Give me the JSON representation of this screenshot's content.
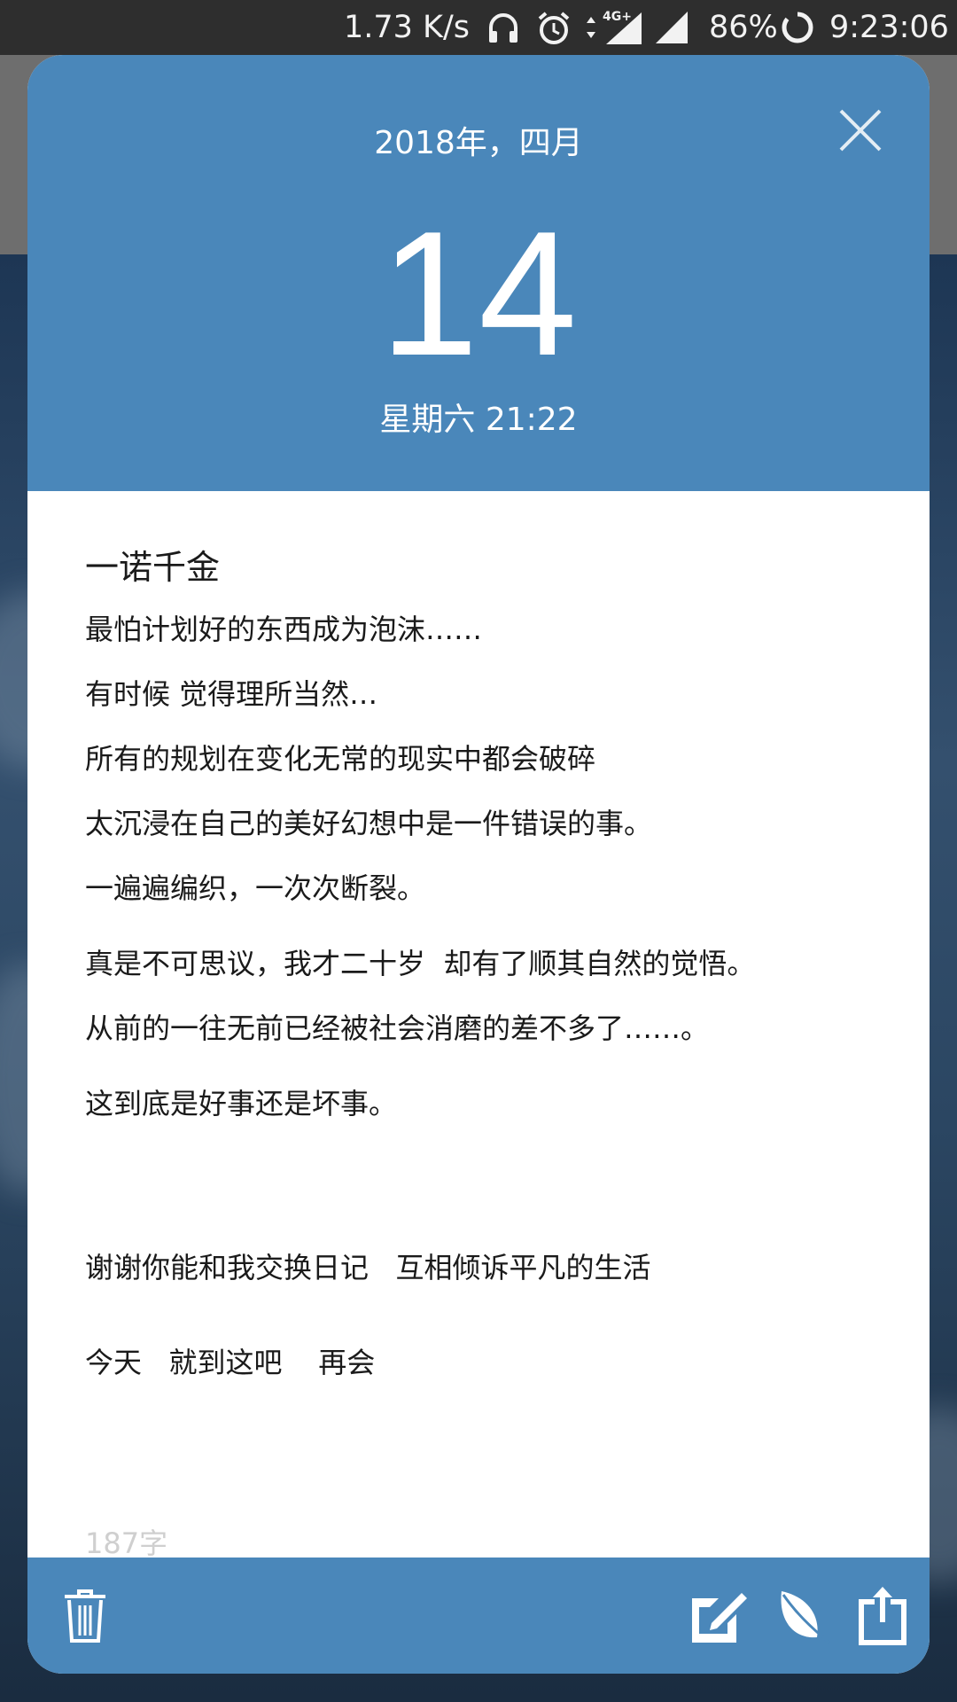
{
  "status_bar": {
    "network_speed": "1.73 K/s",
    "network_type": "4G+",
    "battery": "86%",
    "time": "9:23:06",
    "icons": [
      "headphones-icon",
      "alarm-icon",
      "data-arrows-icon",
      "signal-4g-icon",
      "signal-icon",
      "battery-ring-icon"
    ]
  },
  "diary": {
    "year_month": "2018年，四月",
    "day": "14",
    "weekday_time": "星期六 21:22",
    "title": "一诺千金",
    "lines": [
      "最怕计划好的东西成为泡沫……",
      "有时候 觉得理所当然…",
      "所有的规划在变化无常的现实中都会破碎",
      "太沉浸在自己的美好幻想中是一件错误的事。",
      "一遍遍编织，一次次断裂。",
      "真是不可思议，我才二十岁  却有了顺其自然的觉悟。",
      "从前的一往无前已经被社会消磨的差不多了……。",
      "这到底是好事还是坏事。",
      "谢谢你能和我交换日记   互相倾诉平凡的生活",
      "今天   就到这吧    再会"
    ],
    "word_count": "187字"
  },
  "toolbar": {
    "icons": [
      "trash-icon",
      "edit-icon",
      "leaf-icon",
      "share-icon"
    ]
  },
  "colors": {
    "accent": "#4a87ba",
    "card_bg": "#ffffff",
    "status_bar_bg": "#2e2e2e"
  }
}
